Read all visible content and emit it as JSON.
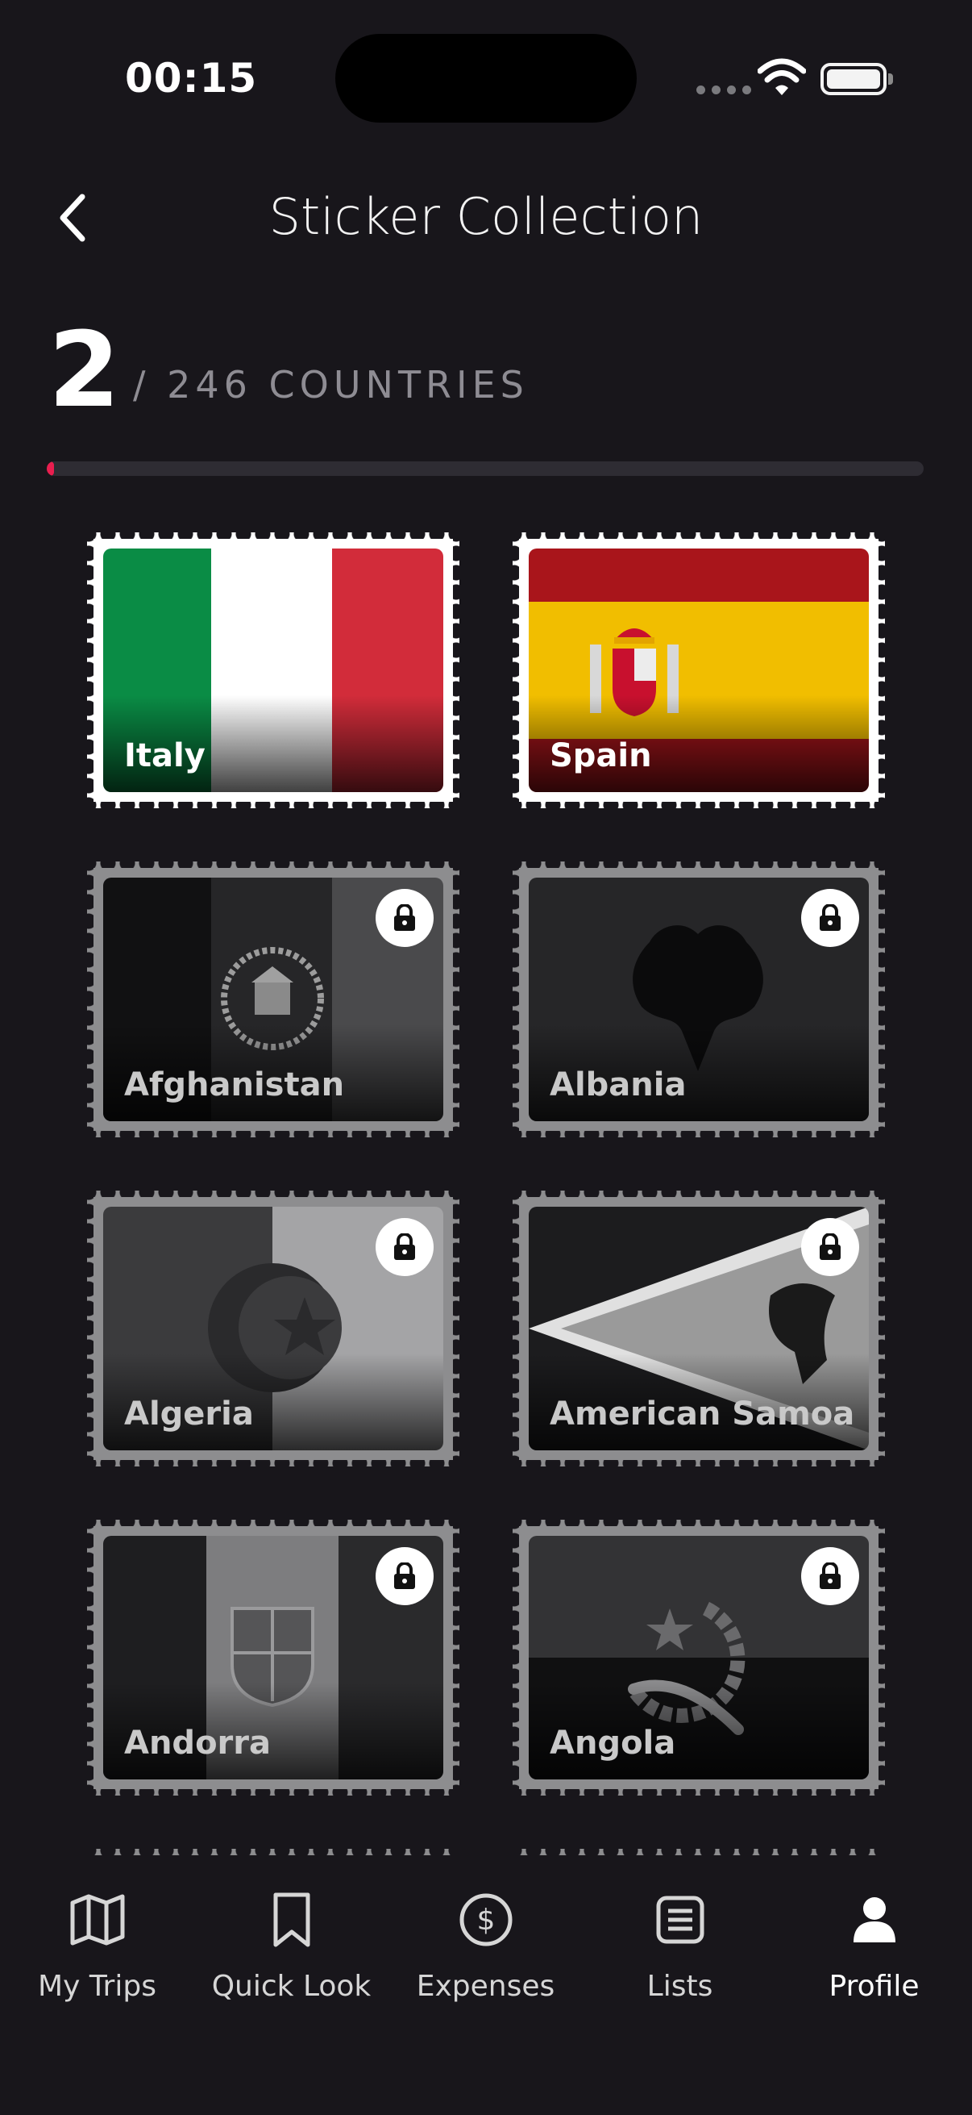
{
  "status": {
    "time": "00:15"
  },
  "header": {
    "title": "Sticker Collection"
  },
  "progress": {
    "collected": "2",
    "total_label": "/ 246 COUNTRIES",
    "fraction": 0.008
  },
  "stamps": [
    {
      "name": "Italy",
      "locked": false
    },
    {
      "name": "Spain",
      "locked": false
    },
    {
      "name": "Afghanistan",
      "locked": true
    },
    {
      "name": "Albania",
      "locked": true
    },
    {
      "name": "Algeria",
      "locked": true
    },
    {
      "name": "American Samoa",
      "locked": true
    },
    {
      "name": "Andorra",
      "locked": true
    },
    {
      "name": "Angola",
      "locked": true
    }
  ],
  "tabs": [
    {
      "label": "My Trips",
      "icon": "map-icon",
      "active": false
    },
    {
      "label": "Quick Look",
      "icon": "bookmark-icon",
      "active": false
    },
    {
      "label": "Expenses",
      "icon": "dollar-icon",
      "active": false
    },
    {
      "label": "Lists",
      "icon": "list-icon",
      "active": false
    },
    {
      "label": "Profile",
      "icon": "person-icon",
      "active": true
    }
  ],
  "colors": {
    "accent": "#e91e4f",
    "background": "#18161b",
    "locked_frame": "#8d8d8f"
  }
}
